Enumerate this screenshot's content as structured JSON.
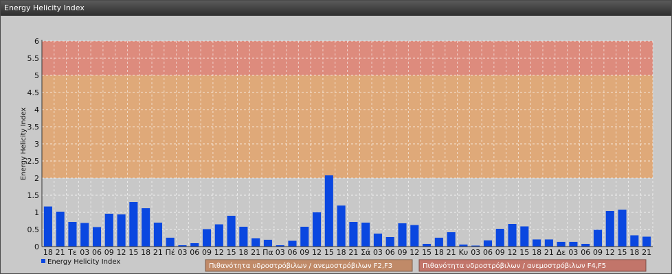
{
  "window_title": "Energy Helicity Index",
  "colors": {
    "bar": "#0a47e0",
    "zone_low": "#c8c8c8",
    "zone_mid": "#e3a36b",
    "zone_high": "#e08070",
    "zone_f2f3_box": "#c08a68",
    "zone_f4f5_box": "#c2756a"
  },
  "legend": {
    "series_label": "Energy Helicity Index",
    "zone_f2f3": "Πιθανότητα υδροστρόβιλων / ανεμοστρόβιλων F2,F3",
    "zone_f4f5": "Πιθανότητα υδροστρόβιλων / ανεμοστρόβιλων F4,F5"
  },
  "chart_data": {
    "type": "bar",
    "ylabel": "Energy Helicity Index",
    "ylim": [
      0,
      6
    ],
    "yticks": [
      "0",
      "0.5",
      "1",
      "1.5",
      "2",
      "2.5",
      "3",
      "3.5",
      "4",
      "4.5",
      "5",
      "5.5",
      "6"
    ],
    "grid": true,
    "legend_position": "bottom-left",
    "zones": [
      {
        "from": 0,
        "to": 2,
        "color": "#c8c8c8"
      },
      {
        "from": 2,
        "to": 5,
        "color": "#e3a36b"
      },
      {
        "from": 5,
        "to": 6,
        "color": "#e08070"
      }
    ],
    "categories": [
      "18",
      "21",
      "Τε",
      "03",
      "06",
      "09",
      "12",
      "15",
      "18",
      "21",
      "Πέ",
      "03",
      "06",
      "09",
      "12",
      "15",
      "18",
      "21",
      "Πα",
      "03",
      "06",
      "09",
      "12",
      "15",
      "18",
      "21",
      "Σά",
      "03",
      "06",
      "09",
      "12",
      "15",
      "18",
      "21",
      "Κυ",
      "03",
      "06",
      "09",
      "12",
      "15",
      "18",
      "21",
      "Δε",
      "03",
      "06",
      "09",
      "12",
      "15",
      "18",
      "21"
    ],
    "series": [
      {
        "name": "Energy Helicity Index",
        "values": [
          1.17,
          1.02,
          0.72,
          0.69,
          0.57,
          0.96,
          0.94,
          1.3,
          1.12,
          0.7,
          0.26,
          0.04,
          0.1,
          0.51,
          0.65,
          0.9,
          0.58,
          0.24,
          0.2,
          0.04,
          0.17,
          0.58,
          1.0,
          2.08,
          1.2,
          0.72,
          0.7,
          0.38,
          0.28,
          0.68,
          0.63,
          0.08,
          0.26,
          0.42,
          0.06,
          0.03,
          0.18,
          0.52,
          0.66,
          0.59,
          0.21,
          0.21,
          0.14,
          0.14,
          0.08,
          0.49,
          1.04,
          1.08,
          0.33,
          0.29
        ]
      }
    ]
  }
}
